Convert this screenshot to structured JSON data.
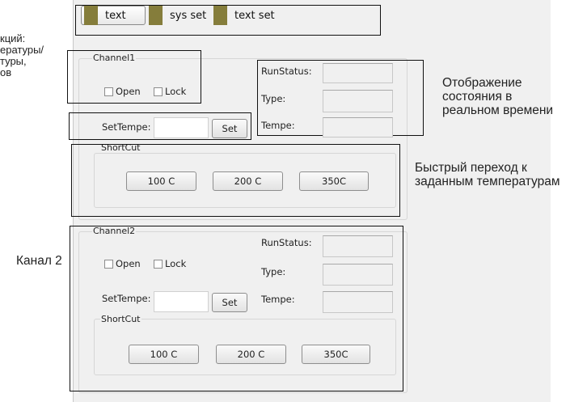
{
  "left_note": {
    "lines": [
      "кций:",
      "ературы/",
      "туры,",
      "ов"
    ]
  },
  "toolbar": {
    "tabs": [
      {
        "label": "text"
      },
      {
        "label": "sys set"
      },
      {
        "label": "text set"
      }
    ]
  },
  "channel1": {
    "title": "Channel1",
    "open_label": "Open",
    "lock_label": "Lock",
    "settempe_label": "SetTempe:",
    "set_button": "Set",
    "runstatus_label": "RunStatus:",
    "type_label": "Type:",
    "tempe_label": "Tempe:",
    "shortcut_title": "ShortCut",
    "shortcuts": [
      "100 C",
      "200 C",
      "350C"
    ]
  },
  "channel2": {
    "title": "Channel2",
    "open_label": "Open",
    "lock_label": "Lock",
    "settempe_label": "SetTempe:",
    "set_button": "Set",
    "runstatus_label": "RunStatus:",
    "type_label": "Type:",
    "tempe_label": "Tempe:",
    "shortcut_title": "ShortCut",
    "shortcuts": [
      "100 C",
      "200 C",
      "350C"
    ]
  },
  "annotations": {
    "status_lines": [
      "Отображение",
      "состояния в",
      "реальном времени"
    ],
    "shortcut_lines": [
      "Быстрый переход к",
      "заданным температурам"
    ],
    "channel2_note": "Канал 2"
  },
  "colors": {
    "tab_swatch": "#857d3b",
    "panel_bg": "#f0f0f0"
  }
}
